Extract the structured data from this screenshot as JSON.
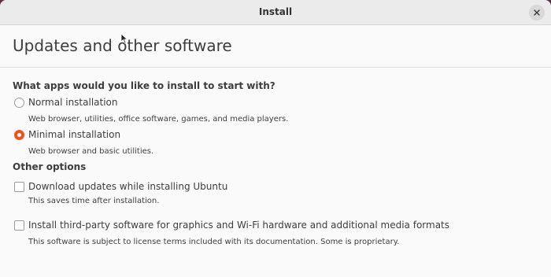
{
  "window": {
    "title": "Install"
  },
  "page": {
    "title": "Updates and other software"
  },
  "apps_section": {
    "question": "What apps would you like to install to start with?",
    "options": [
      {
        "label": "Normal installation",
        "description": "Web browser, utilities, office software, games, and media players.",
        "selected": false
      },
      {
        "label": "Minimal installation",
        "description": "Web browser and basic utilities.",
        "selected": true
      }
    ]
  },
  "other_options": {
    "heading": "Other options",
    "items": [
      {
        "label": "Download updates while installing Ubuntu",
        "description": "This saves time after installation.",
        "checked": false
      },
      {
        "label": "Install third-party software for graphics and Wi-Fi hardware and additional media formats",
        "description": "This software is subject to license terms included with its documentation. Some is proprietary.",
        "checked": false
      }
    ]
  },
  "colors": {
    "accent": "#e95420",
    "background": "#fafafa",
    "titlebar": "#ebebeb"
  },
  "icons": {
    "close": "close-icon",
    "cursor": "mouse-pointer-icon"
  }
}
